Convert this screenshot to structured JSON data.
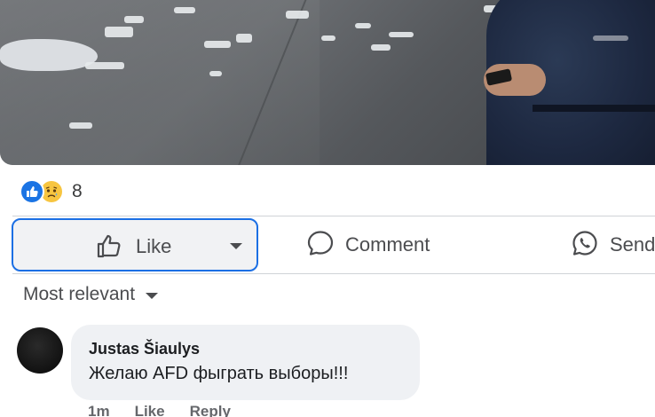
{
  "post": {
    "reaction_types": [
      "like-icon",
      "sad-icon"
    ],
    "reaction_count": "8"
  },
  "actions": {
    "like_label": "Like",
    "comment_label": "Comment",
    "send_label": "Send"
  },
  "comments_section": {
    "sort_label": "Most relevant",
    "comments": [
      {
        "author": "Justas Šiaulys",
        "text": "Желаю AFD фыграть выборы!!!",
        "time": "1m",
        "like_label": "Like",
        "reply_label": "Reply"
      }
    ]
  },
  "colors": {
    "accent": "#1b6fe4",
    "like_reaction": "#1b74e4",
    "sad_reaction": "#f7c540",
    "bubble": "#eff1f4"
  }
}
